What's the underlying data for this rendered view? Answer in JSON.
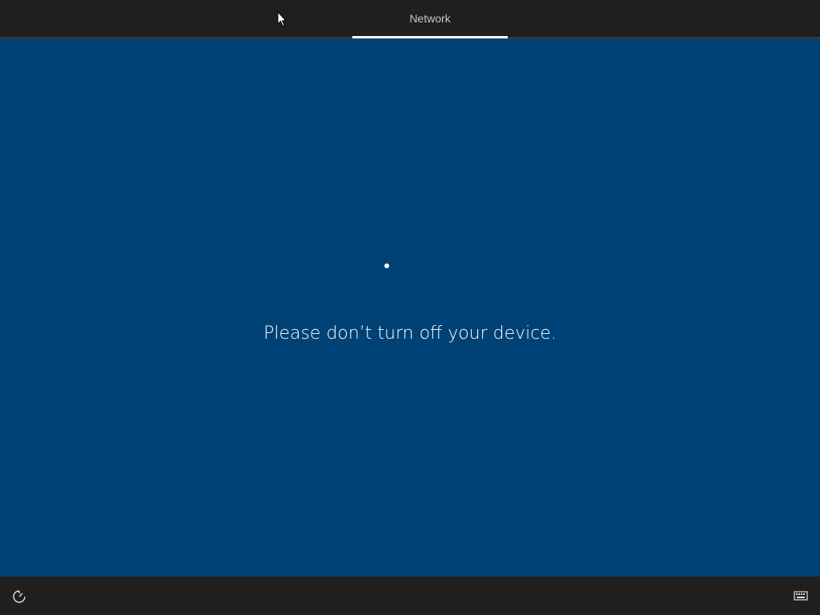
{
  "header": {
    "tab_label": "Network"
  },
  "main": {
    "status_message": "Please don’t turn off your device."
  },
  "footer": {
    "left_icon": "ease-of-access-icon",
    "right_icon": "keyboard-icon"
  },
  "colors": {
    "background": "#004275",
    "bar": "#1f1f1f",
    "accent_underline": "#ffffff"
  }
}
